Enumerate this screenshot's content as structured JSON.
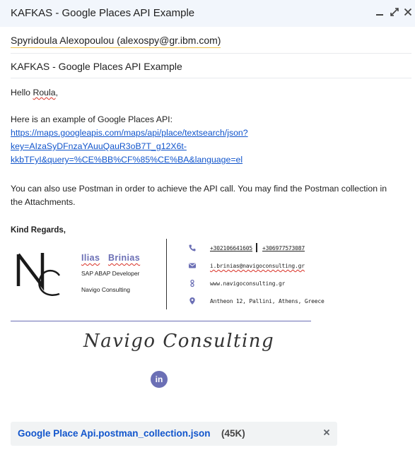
{
  "window": {
    "title": "KAFKAS - Google Places API Example",
    "controls": [
      "minimize-icon",
      "popout-icon",
      "close-icon"
    ]
  },
  "recipient": "Spyridoula Alexopoulou (alexospy@gr.ibm.com)",
  "subject": "KAFKAS - Google Places API Example",
  "body": {
    "greeting_prefix": "Hello ",
    "greeting_name": "Roula",
    "greeting_suffix": ",",
    "intro": "Here is an example of Google Places API:",
    "link_line1": "https://maps.googleapis.com/maps/api/place/textsearch/json?",
    "link_line2": "key=AIzaSyDFnzaYAuuQauR3oB7T_g12X6t-",
    "link_line3": "kkbTFyI&query=%CE%BB%CF%85%CE%BA&language=el",
    "postman_line1": "You can also use Postman in order to achieve the API call. You may find the Postman collection in",
    "postman_line2": "the Attachments."
  },
  "signature": {
    "regards": "Kind Regards,",
    "logo_letters": "NC",
    "first_name": "Ilias",
    "last_name": "Brinias",
    "role": "SAP ABAP Developer",
    "company": "Navigo Consulting",
    "phone1": "+302106641605",
    "phone2": "+306977573087",
    "email": "i.brinias@navigoconsulting.gr",
    "website": "www.navigoconsulting.gr",
    "address": "Antheon 12, Pallini, Athens, Greece",
    "script_logo": "Navigo Consulting",
    "linkedin": "in",
    "icons": [
      "phone-icon",
      "email-icon",
      "website-icon",
      "location-icon",
      "linkedin-icon"
    ],
    "accent_color": "#6b6fb5"
  },
  "attachment": {
    "filename": "Google Place Api.postman_collection.json",
    "size": "(45K)"
  }
}
